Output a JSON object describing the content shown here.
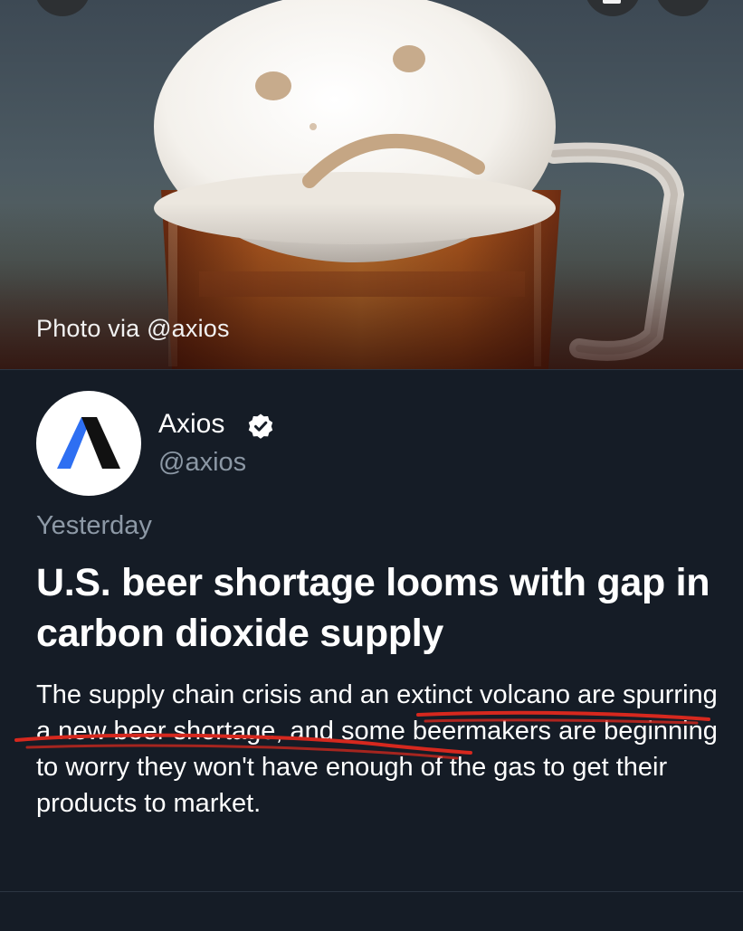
{
  "hero": {
    "caption": "Photo via @axios"
  },
  "tweet": {
    "author": {
      "name": "Axios",
      "handle": "@axios",
      "verified": true
    },
    "timestamp": "Yesterday",
    "headline": "U.S. beer shortage looms with gap in carbon dioxide supply",
    "summary": "The supply chain crisis and an extinct volcano are spurring a new beer shortage, and some beermakers are beginning to worry they won't have enough of the gas to get their products to market."
  },
  "icons": {
    "avatar_logo": "axios-logo-icon",
    "verified": "verified-check-icon"
  },
  "colors": {
    "background": "#151c26",
    "handle_text": "#8b97a4",
    "annotation_red": "#d6281e",
    "axios_blue": "#2e6ff2"
  }
}
